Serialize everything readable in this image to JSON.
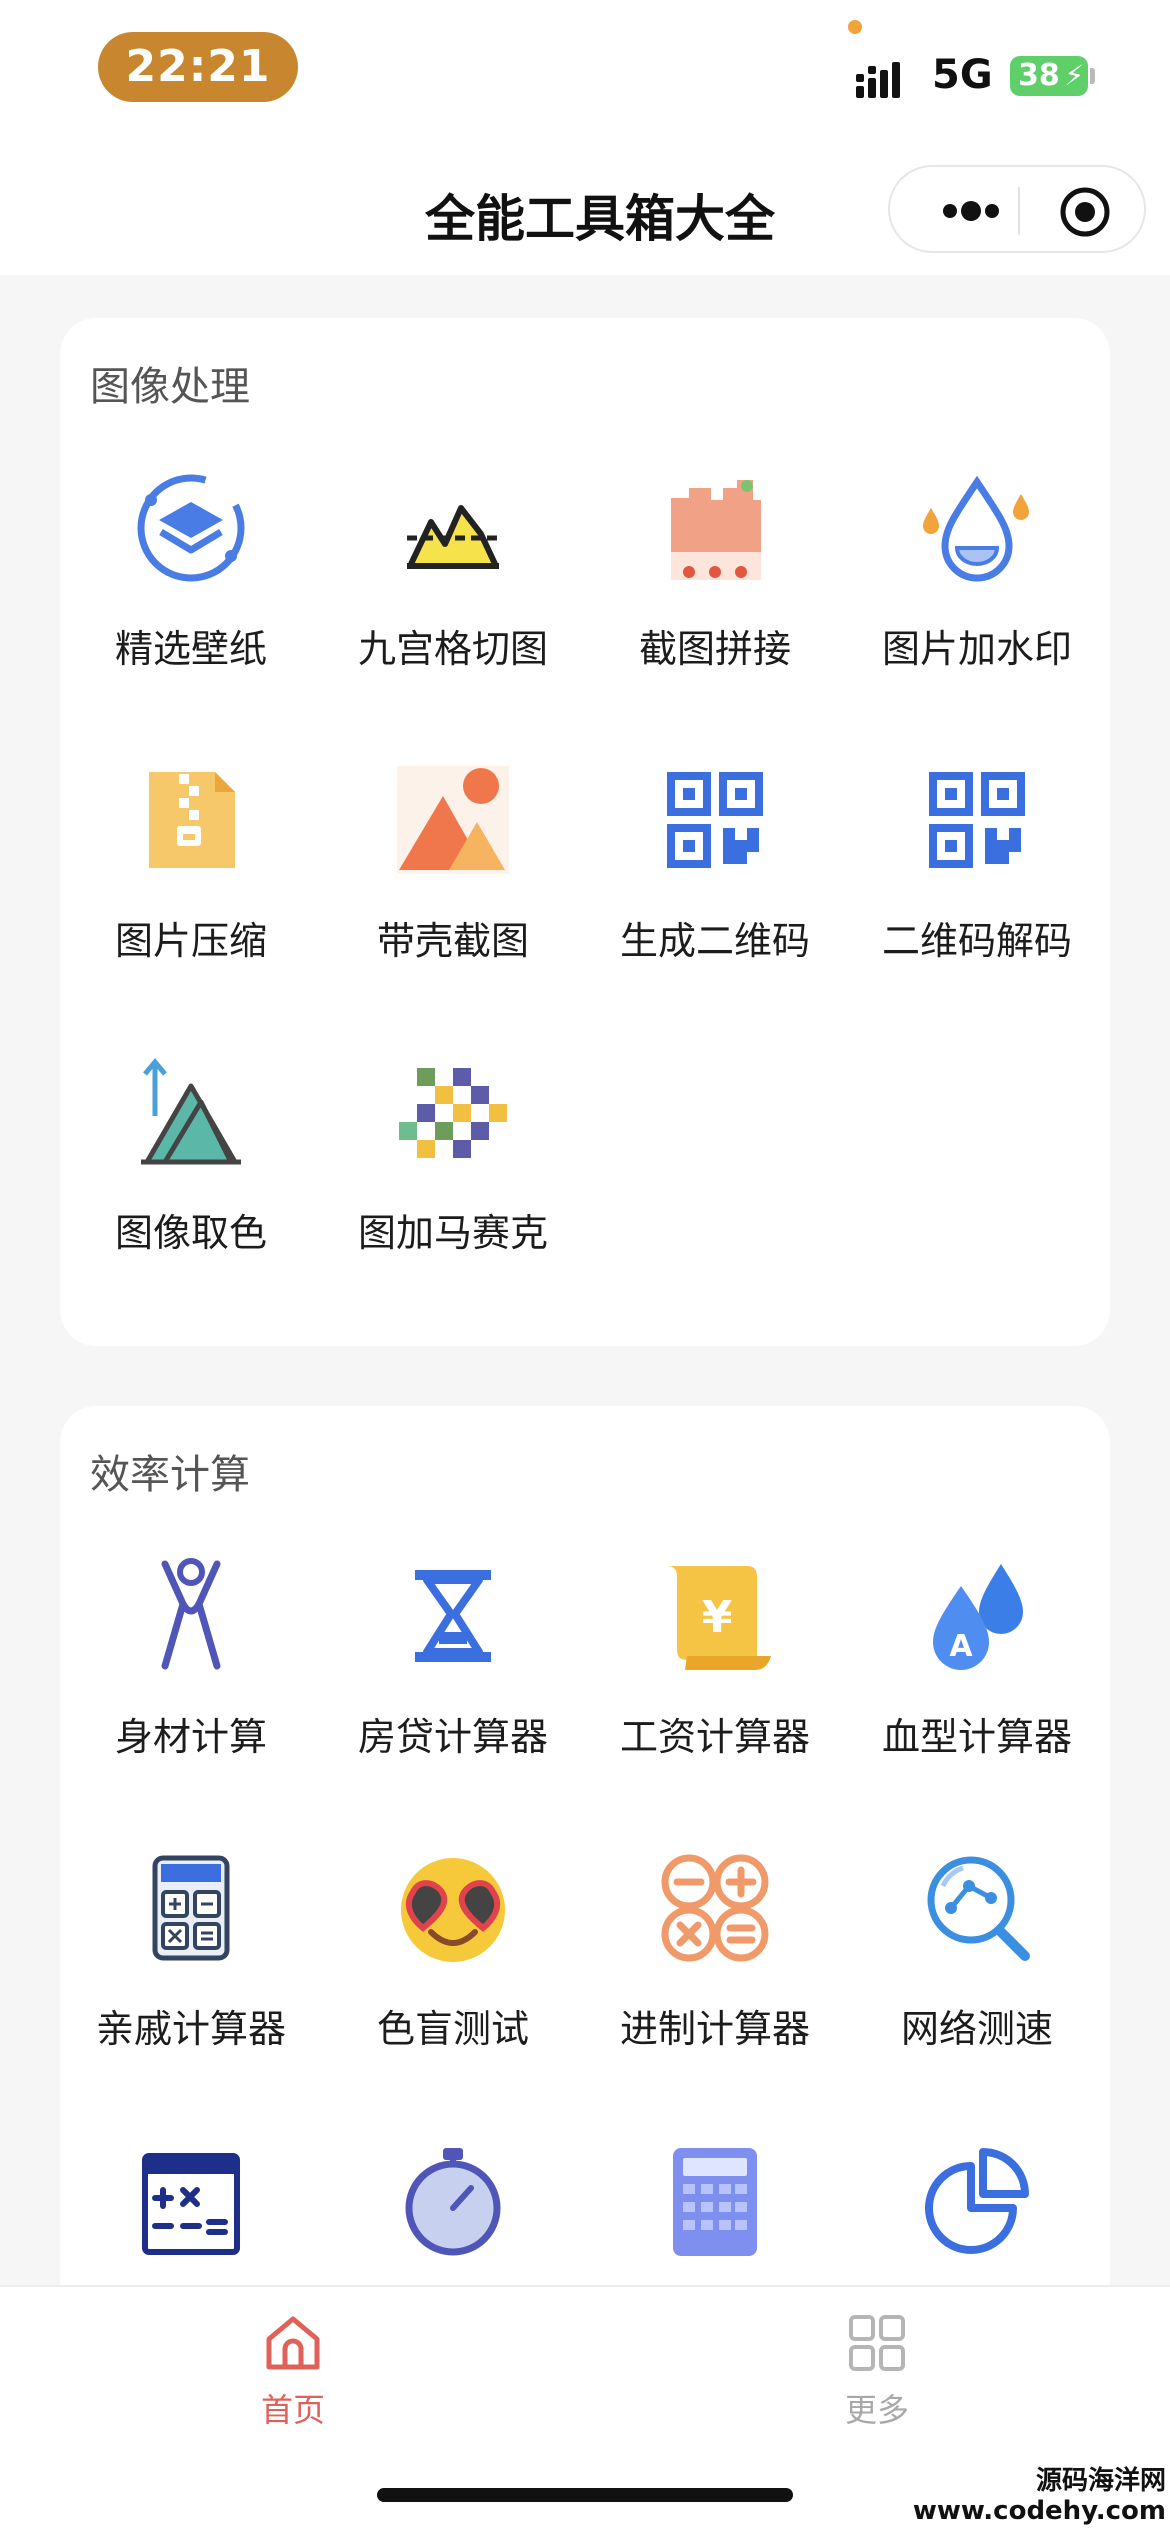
{
  "status_bar": {
    "time": "22:21",
    "network": "5G",
    "battery_percent": "38"
  },
  "header": {
    "title": "全能工具箱大全"
  },
  "sections": [
    {
      "title": "图像处理",
      "tools": [
        {
          "label": "精选壁纸",
          "icon": "wallpaper-layers-icon"
        },
        {
          "label": "九宫格切图",
          "icon": "grid-cut-mountain-icon"
        },
        {
          "label": "截图拼接",
          "icon": "screenshot-stitch-icon"
        },
        {
          "label": "图片加水印",
          "icon": "watermark-drop-icon"
        },
        {
          "label": "图片压缩",
          "icon": "zip-compress-icon"
        },
        {
          "label": "带壳截图",
          "icon": "landscape-image-icon"
        },
        {
          "label": "生成二维码",
          "icon": "qr-code-icon"
        },
        {
          "label": "二维码解码",
          "icon": "qr-code-decode-icon"
        },
        {
          "label": "图像取色",
          "icon": "color-picker-mountain-icon"
        },
        {
          "label": "图加马赛克",
          "icon": "mosaic-icon"
        }
      ]
    },
    {
      "title": "效率计算",
      "tools": [
        {
          "label": "身材计算",
          "icon": "body-figure-icon"
        },
        {
          "label": "房贷计算器",
          "icon": "hourglass-icon"
        },
        {
          "label": "工资计算器",
          "icon": "yuan-scroll-icon"
        },
        {
          "label": "血型计算器",
          "icon": "blood-drop-icon"
        },
        {
          "label": "亲戚计算器",
          "icon": "calculator-icon"
        },
        {
          "label": "色盲测试",
          "icon": "heart-glasses-emoji-icon"
        },
        {
          "label": "进制计算器",
          "icon": "math-operators-icon"
        },
        {
          "label": "网络测速",
          "icon": "network-search-icon"
        },
        {
          "label": "",
          "icon": "math-board-icon"
        },
        {
          "label": "",
          "icon": "stopwatch-icon"
        },
        {
          "label": "",
          "icon": "keypad-calculator-icon"
        },
        {
          "label": "",
          "icon": "pie-chart-icon"
        }
      ]
    }
  ],
  "tab_bar": {
    "items": [
      {
        "label": "首页",
        "icon": "home-icon",
        "active": true
      },
      {
        "label": "更多",
        "icon": "grid-more-icon",
        "active": false
      }
    ]
  },
  "watermark": {
    "line1": "源码海洋网",
    "line2": "www.codehy.com"
  }
}
